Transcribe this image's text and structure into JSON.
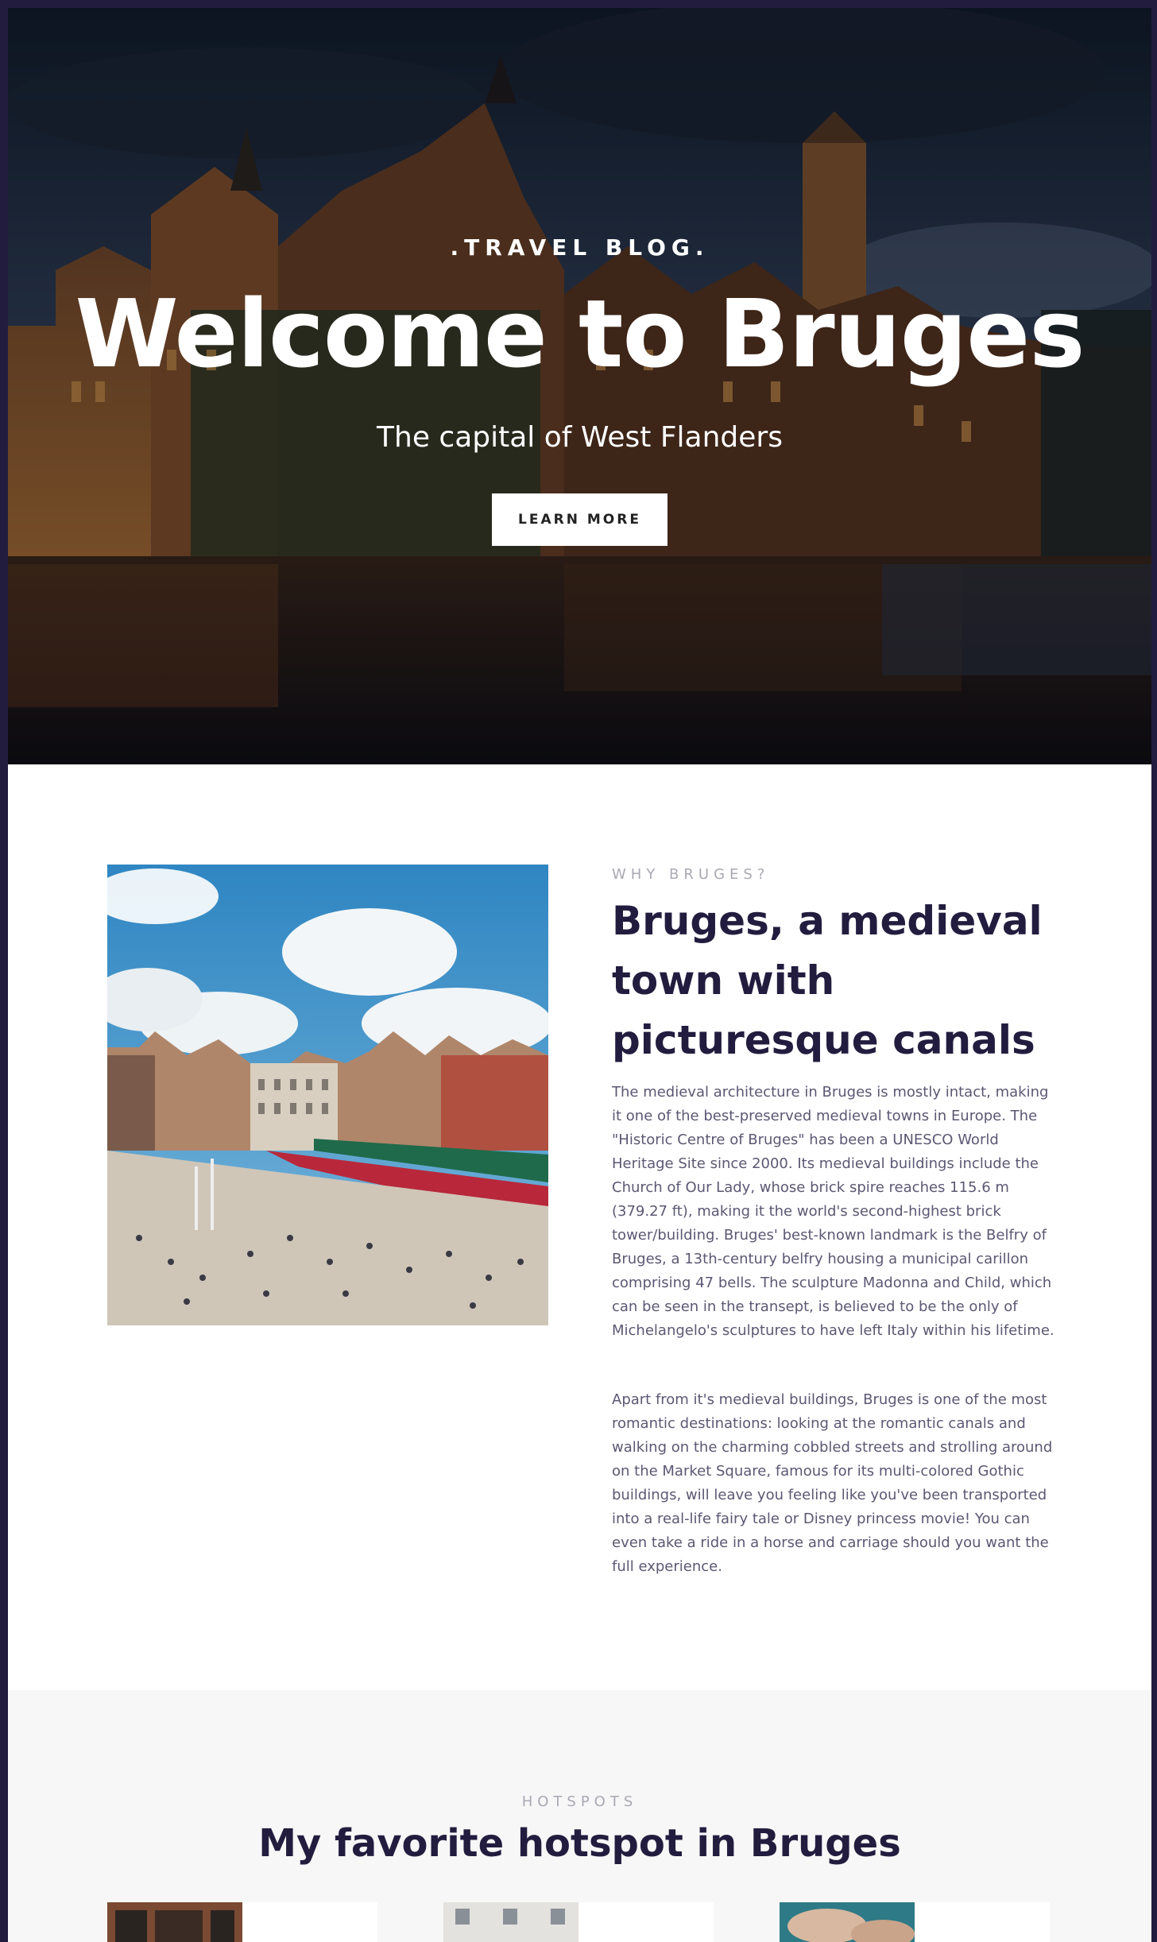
{
  "hero": {
    "kicker": ".TRAVEL BLOG.",
    "title": "Welcome to Bruges",
    "subtitle": "The capital of West Flanders",
    "button_label": "LEARN MORE"
  },
  "about": {
    "kicker": "WHY BRUGES?",
    "heading": "Bruges, a medieval town with picturesque canals",
    "paragraphs": [
      "The medieval architecture in Bruges is mostly intact, making it one of the best-preserved medieval towns in Europe. The \"Historic Centre of Bruges\" has been a UNESCO World Heritage Site since 2000. Its medieval buildings include the Church of Our Lady, whose brick spire reaches 115.6 m (379.27 ft), making it the world's second-highest brick tower/building. Bruges' best-known landmark is the Belfry of Bruges, a 13th-century belfry housing a municipal carillon comprising 47 bells. The sculpture Madonna and Child, which can be seen in the transept, is believed to be the only of Michelangelo's sculptures to have left Italy within his lifetime.",
      "Apart from it's medieval buildings, Bruges is one of the most romantic destinations: looking at the romantic canals and walking on the charming cobbled streets and strolling around on the Market Square, famous for its multi-colored Gothic buildings, will leave you feeling like you've been transported into a real-life fairy tale or Disney princess movie! You can even take a ride in a horse and carriage should you want the full experience."
    ]
  },
  "hotspots": {
    "kicker": "HOTSPOTS",
    "title": "My favorite hotspot in Bruges"
  },
  "colors": {
    "page_border": "#221d3f",
    "heading": "#221d3f",
    "body_text": "#5b5873",
    "kicker": "#a9a9b3",
    "section_bg": "#f7f7f7"
  }
}
